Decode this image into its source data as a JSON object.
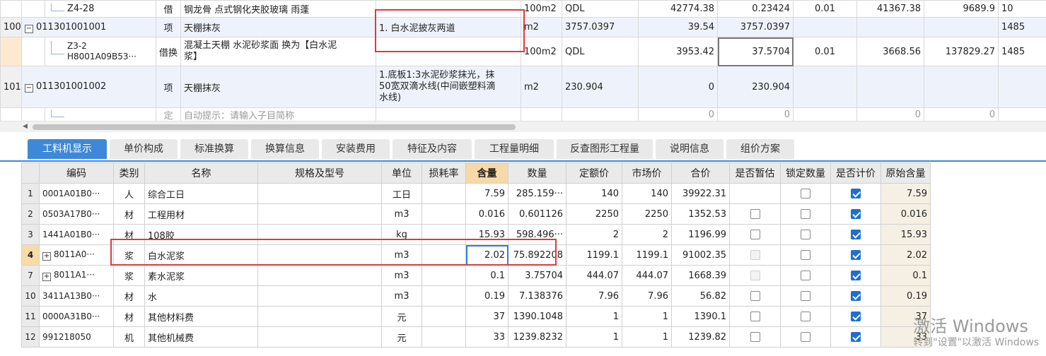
{
  "top_rows": [
    {
      "no": "",
      "code": "Z4-28",
      "type": "借",
      "name": "钢龙骨 点式钢化夹胶玻璃 雨蓬",
      "feature": "",
      "unit": "100m2",
      "qty_expr": "QDL",
      "c1": "42774.38",
      "c2": "0.23424",
      "c3": "0.01",
      "c4": "41367.38",
      "c5": "9689.9",
      "c6": "10"
    },
    {
      "no": "100",
      "code": "011301001001",
      "type": "项",
      "name": "天棚抹灰",
      "feature": "1. 白水泥披灰两道",
      "unit": "m2",
      "qty_expr": "3757.0397",
      "c1": "39.54",
      "c2": "3757.0397",
      "c3": "",
      "c4": "",
      "c5": "",
      "c6": "1485"
    },
    {
      "no": "",
      "code": "Z3-2 H8001A09B53···",
      "code_line1": "Z3-2",
      "code_line2": "H8001A09B53···",
      "type": "借换",
      "name": "混凝土天棚 水泥砂浆面  换为【白水泥浆】",
      "name_line1": "混凝土天棚 水泥砂浆面  换为【白水泥",
      "name_line2": "浆】",
      "feature": "",
      "unit": "100m2",
      "qty_expr": "QDL",
      "c1": "3953.42",
      "c2": "37.5704",
      "c3": "0.01",
      "c4": "3668.56",
      "c5": "137829.27",
      "c6": "1485"
    },
    {
      "no": "101",
      "code": "011301001002",
      "type": "项",
      "name": "天棚抹灰",
      "feature": "1.底板1:3水泥砂浆抹光，抹50宽双滴水线(中间嵌塑料滴水线)",
      "feature_line1": "1.底板1:3水泥砂浆抹光，抹",
      "feature_line2": "50宽双滴水线(中间嵌塑料滴",
      "feature_line3": "水线)",
      "unit": "m2",
      "qty_expr": "230.904",
      "c1": "0",
      "c2": "230.904",
      "c3": "",
      "c4": "",
      "c5": "",
      "c6": ""
    },
    {
      "no": "",
      "code": "",
      "type": "定",
      "name": "自动提示：请输入子目简称",
      "feature": "",
      "unit": "",
      "qty_expr": "",
      "c1": "0",
      "c2": "0",
      "c3": "",
      "c4": "0",
      "c5": "0",
      "c6": ""
    }
  ],
  "tabs": [
    "工料机显示",
    "单价构成",
    "标准换算",
    "换算信息",
    "安装费用",
    "特征及内容",
    "工程量明细",
    "反查图形工程量",
    "说明信息",
    "组价方案"
  ],
  "active_tab": "工料机显示",
  "columns": [
    "编码",
    "类别",
    "名称",
    "规格及型号",
    "单位",
    "损耗率",
    "含量",
    "数量",
    "定额价",
    "市场价",
    "合价",
    "是否暂估",
    "锁定数量",
    "是否计价",
    "原始含量"
  ],
  "rows": [
    {
      "rn": "1",
      "expand": false,
      "code": "0001A01B0···",
      "cat": "人",
      "name": "综合工日",
      "spec": "",
      "unit": "工日",
      "loss": "",
      "content": "7.59",
      "qty": "285.159···",
      "base": "140",
      "market": "140",
      "total": "39922.31",
      "estimate": "none",
      "lock": "off",
      "priced": "on",
      "orig": "7.59"
    },
    {
      "rn": "2",
      "expand": false,
      "code": "0503A17B0···",
      "cat": "材",
      "name": "工程用材",
      "spec": "",
      "unit": "m3",
      "loss": "",
      "content": "0.016",
      "qty": "0.601126",
      "base": "2250",
      "market": "2250",
      "total": "1352.53",
      "estimate": "off",
      "lock": "off",
      "priced": "on",
      "orig": "0.016"
    },
    {
      "rn": "3",
      "expand": false,
      "code": "1441A01B0···",
      "cat": "材",
      "name": "108胶",
      "spec": "",
      "unit": "kg",
      "loss": "",
      "content": "15.93",
      "qty": "598.496···",
      "base": "2",
      "market": "2",
      "total": "1196.99",
      "estimate": "off",
      "lock": "off",
      "priced": "on",
      "orig": "15.93"
    },
    {
      "rn": "4",
      "expand": true,
      "code": "8011A0···",
      "cat": "浆",
      "name": "白水泥浆",
      "spec": "",
      "unit": "m3",
      "loss": "",
      "content": "2.02",
      "qty": "75.892208",
      "base": "1199.1",
      "market": "1199.1",
      "total": "91002.35",
      "estimate": "disabled",
      "lock": "off",
      "priced": "on",
      "orig": "2.02"
    },
    {
      "rn": "7",
      "expand": true,
      "code": "8011A1···",
      "cat": "浆",
      "name": "素水泥浆",
      "spec": "",
      "unit": "m3",
      "loss": "",
      "content": "0.1",
      "qty": "3.75704",
      "base": "444.07",
      "market": "444.07",
      "total": "1668.39",
      "estimate": "disabled",
      "lock": "off",
      "priced": "on",
      "orig": "0.1"
    },
    {
      "rn": "10",
      "expand": false,
      "code": "3411A13B0···",
      "cat": "材",
      "name": "水",
      "spec": "",
      "unit": "m3",
      "loss": "",
      "content": "0.19",
      "qty": "7.138376",
      "base": "7.96",
      "market": "7.96",
      "total": "56.82",
      "estimate": "off",
      "lock": "off",
      "priced": "on",
      "orig": "0.19"
    },
    {
      "rn": "11",
      "expand": false,
      "code": "0000A31B0···",
      "cat": "材",
      "name": "其他材料费",
      "spec": "",
      "unit": "元",
      "loss": "",
      "content": "37",
      "qty": "1390.1048",
      "base": "1",
      "market": "1",
      "total": "1390.1",
      "estimate": "off",
      "lock": "off",
      "priced": "on",
      "orig": "37"
    },
    {
      "rn": "12",
      "expand": false,
      "code": "991218050",
      "cat": "机",
      "name": "其他机械费",
      "spec": "",
      "unit": "元",
      "loss": "",
      "content": "33",
      "qty": "1239.8232",
      "base": "1",
      "market": "1",
      "total": "1239.82",
      "estimate": "off",
      "lock": "off",
      "priced": "on",
      "orig": "33"
    }
  ],
  "watermark": {
    "line1": "激活 Windows",
    "line2": "转到\"设置\"以激活 Windows"
  },
  "colors": {
    "accent": "#3d88d8",
    "annotation": "#e0393e",
    "checked": "#1f6fd2"
  }
}
